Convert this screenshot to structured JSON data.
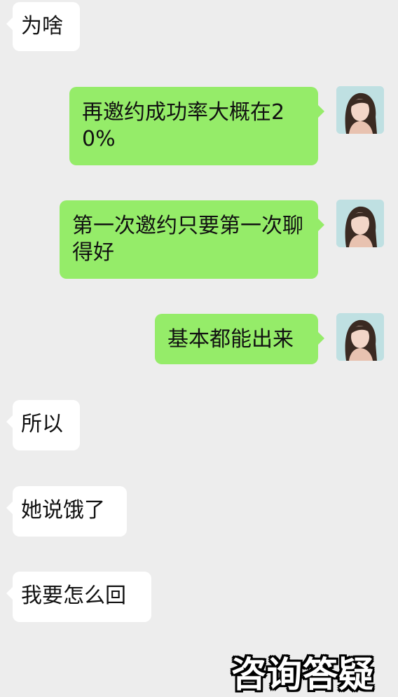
{
  "messages": [
    {
      "side": "in",
      "text": "为啥"
    },
    {
      "side": "out",
      "text": "再邀约成功率大概在20%"
    },
    {
      "side": "out",
      "text": "第一次邀约只要第一次聊得好"
    },
    {
      "side": "out",
      "text": "基本都能出来"
    },
    {
      "side": "in",
      "text": "所以"
    },
    {
      "side": "in",
      "text": "她说饿了"
    },
    {
      "side": "in",
      "text": "我要怎么回"
    }
  ],
  "watermark": "咨询答疑",
  "avatar": {
    "icon": "girl-portrait-icon"
  },
  "colors": {
    "background": "#ededed",
    "incoming": "#ffffff",
    "outgoing": "#95ec69"
  }
}
